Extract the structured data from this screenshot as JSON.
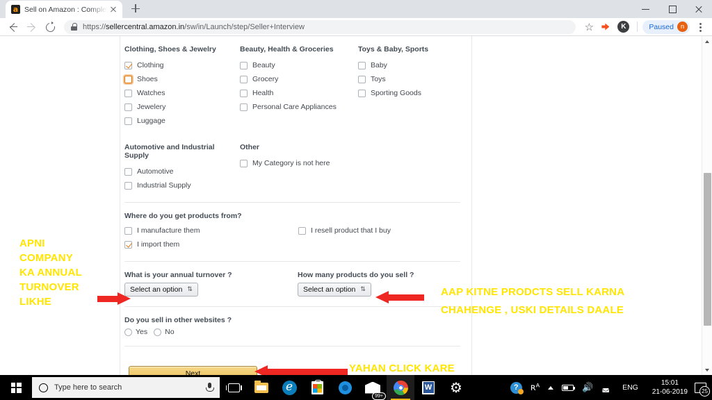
{
  "browser": {
    "tab": {
      "title": "Sell on Amazon : Complete your",
      "favicon": "amazon-favicon",
      "close": "×"
    },
    "newtab_label": "+",
    "window_controls": {
      "minimize": "–",
      "maximize": "❐",
      "close": "×"
    },
    "nav": {
      "back": "←",
      "forward": "→",
      "reload": "↻"
    },
    "omnibox": {
      "scheme": "https://",
      "host": "sellercentral.amazon.in",
      "path": "/sw/in/Launch/step/Seller+Interview",
      "lock": "lock-icon"
    },
    "toolbar": {
      "bookmark": "☆",
      "profile_initial": "K",
      "paused_label": "Paused",
      "paused_avatar": "n",
      "menu": "⋮"
    }
  },
  "page": {
    "categories": [
      {
        "heading": "Clothing, Shoes & Jewelry",
        "items": [
          {
            "label": "Clothing",
            "checked": true,
            "focused": false
          },
          {
            "label": "Shoes",
            "checked": false,
            "focused": true
          },
          {
            "label": "Watches",
            "checked": false,
            "focused": false
          },
          {
            "label": "Jewelery",
            "checked": false,
            "focused": false
          },
          {
            "label": "Luggage",
            "checked": false,
            "focused": false
          }
        ]
      },
      {
        "heading": "Beauty, Health & Groceries",
        "items": [
          {
            "label": "Beauty",
            "checked": false,
            "focused": false
          },
          {
            "label": "Grocery",
            "checked": false,
            "focused": false
          },
          {
            "label": "Health",
            "checked": false,
            "focused": false
          },
          {
            "label": "Personal Care Appliances",
            "checked": false,
            "focused": false
          }
        ]
      },
      {
        "heading": "Toys & Baby, Sports",
        "items": [
          {
            "label": "Baby",
            "checked": false,
            "focused": false
          },
          {
            "label": "Toys",
            "checked": false,
            "focused": false
          },
          {
            "label": "Sporting Goods",
            "checked": false,
            "focused": false
          }
        ]
      }
    ],
    "categories_row2": [
      {
        "heading": "Automotive and Industrial Supply",
        "items": [
          {
            "label": "Automotive",
            "checked": false,
            "focused": false
          },
          {
            "label": "Industrial Supply",
            "checked": false,
            "focused": false
          }
        ]
      },
      {
        "heading": "Other",
        "items": [
          {
            "label": "My Category is not here",
            "checked": false,
            "focused": false
          }
        ]
      }
    ],
    "source_question": {
      "title": "Where do you get products from?",
      "options": [
        {
          "label": "I manufacture them",
          "checked": false
        },
        {
          "label": "I resell product that I buy",
          "checked": false
        },
        {
          "label": "I import them",
          "checked": true
        }
      ]
    },
    "turnover_question": {
      "label": "What is your annual turnover ?",
      "select_value": "Select an option",
      "caret": "⇅"
    },
    "products_question": {
      "label": "How many products do you sell ?",
      "select_value": "Select an option",
      "caret": "⇅"
    },
    "other_websites_question": {
      "label": "Do you sell in other websites ?",
      "options": [
        {
          "label": "Yes",
          "selected": false
        },
        {
          "label": "No",
          "selected": false
        }
      ]
    },
    "next_button": "Next"
  },
  "annotations": {
    "color": "#ffe500",
    "arrow_color": "#ee2722",
    "left_text": "APNI\nCOMPANY\nKA ANNUAL\nTURNOVER\nLIKHE",
    "right_text": "AAP KITNE PRODCTS SELL KARNA\nCHAHENGE , USKI DETAILS DAALE",
    "next_text": "YAHAN CLICK KARE"
  },
  "taskbar": {
    "start": "windows-logo",
    "search_placeholder": "Type here to search",
    "apps": [
      {
        "name": "task-view",
        "active": false
      },
      {
        "name": "file-explorer",
        "active": false
      },
      {
        "name": "microsoft-edge",
        "active": false
      },
      {
        "name": "microsoft-store",
        "active": false
      },
      {
        "name": "cortana-app",
        "active": false
      },
      {
        "name": "mail-app",
        "active": false,
        "badge": "99+"
      },
      {
        "name": "google-chrome",
        "active": true
      },
      {
        "name": "microsoft-word",
        "active": false
      },
      {
        "name": "settings-app",
        "active": false
      }
    ],
    "tray": {
      "help": "?",
      "people": "ʀᴬ",
      "chevron": "⌃",
      "battery": "battery-icon",
      "volume": "🔊",
      "wifi": "wifi-icon",
      "language": "ENG",
      "time": "15:01",
      "date": "21-06-2019",
      "notifications_count": "25"
    }
  }
}
